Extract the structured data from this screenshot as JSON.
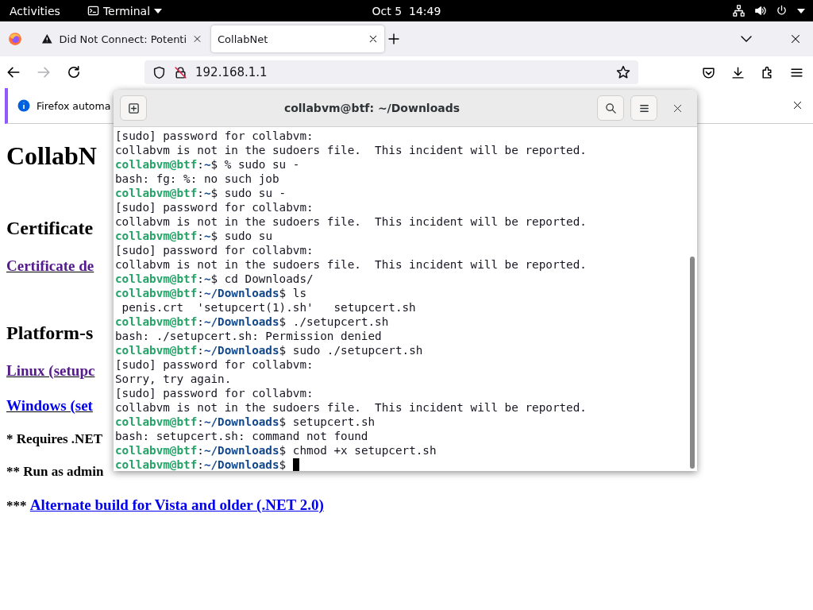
{
  "top_bar": {
    "activities": "Activities",
    "app_menu": "Terminal",
    "clock": "Oct 5  14:49"
  },
  "browser": {
    "tabs": [
      {
        "title": "Did Not Connect: Potenti",
        "kind": "warning",
        "selected": false
      },
      {
        "title": "CollabNet",
        "kind": "plain",
        "selected": true
      }
    ],
    "forward": {
      "disabled": true
    },
    "address": "192.168.1.1",
    "notification": "Firefox automa",
    "page": [
      {
        "kind": "h1",
        "text": "CollabN"
      },
      {
        "kind": "h2",
        "text": "Certificate"
      },
      {
        "kind": "link",
        "text": "Certificate de",
        "visited": true
      },
      {
        "kind": "h2",
        "text": "Platform-s"
      },
      {
        "kind": "link",
        "text": "Linux (setupc",
        "visited": true
      },
      {
        "kind": "link",
        "text": "Windows (set",
        "visited": false
      },
      {
        "kind": "note",
        "text": "* Requires .NET"
      },
      {
        "kind": "note",
        "text": "** Run as admin"
      },
      {
        "kind": "note_link",
        "prefix": "***",
        "text": "Alternate build for Vista and older (.NET 2.0)",
        "visited": false
      }
    ]
  },
  "terminal": {
    "title": "collabvm@btf: ~/Downloads",
    "lines": [
      {
        "kind": "output",
        "text": "[sudo] password for collabvm:"
      },
      {
        "kind": "output",
        "text": "collabvm is not in the sudoers file.  This incident will be reported."
      },
      {
        "kind": "prompt",
        "user": "collabvm@btf",
        "sep": ":",
        "path": "~",
        "rest": "$ % sudo su -",
        "cursor": false
      },
      {
        "kind": "output",
        "text": "bash: fg: %: no such job"
      },
      {
        "kind": "prompt",
        "user": "collabvm@btf",
        "sep": ":",
        "path": "~",
        "rest": "$ sudo su -",
        "cursor": false
      },
      {
        "kind": "output",
        "text": "[sudo] password for collabvm:"
      },
      {
        "kind": "output",
        "text": "collabvm is not in the sudoers file.  This incident will be reported."
      },
      {
        "kind": "prompt",
        "user": "collabvm@btf",
        "sep": ":",
        "path": "~",
        "rest": "$ sudo su",
        "cursor": false
      },
      {
        "kind": "output",
        "text": "[sudo] password for collabvm:"
      },
      {
        "kind": "output",
        "text": "collabvm is not in the sudoers file.  This incident will be reported."
      },
      {
        "kind": "prompt",
        "user": "collabvm@btf",
        "sep": ":",
        "path": "~",
        "rest": "$ cd Downloads/",
        "cursor": false
      },
      {
        "kind": "prompt",
        "user": "collabvm@btf",
        "sep": ":",
        "path": "~/Downloads",
        "rest": "$ ls",
        "cursor": false
      },
      {
        "kind": "output",
        "text": " penis.crt  'setupcert(1).sh'   setupcert.sh"
      },
      {
        "kind": "prompt",
        "user": "collabvm@btf",
        "sep": ":",
        "path": "~/Downloads",
        "rest": "$ ./setupcert.sh",
        "cursor": false
      },
      {
        "kind": "output",
        "text": "bash: ./setupcert.sh: Permission denied"
      },
      {
        "kind": "prompt",
        "user": "collabvm@btf",
        "sep": ":",
        "path": "~/Downloads",
        "rest": "$ sudo ./setupcert.sh",
        "cursor": false
      },
      {
        "kind": "output",
        "text": "[sudo] password for collabvm:"
      },
      {
        "kind": "output",
        "text": "Sorry, try again."
      },
      {
        "kind": "output",
        "text": "[sudo] password for collabvm:"
      },
      {
        "kind": "output",
        "text": "collabvm is not in the sudoers file.  This incident will be reported."
      },
      {
        "kind": "prompt",
        "user": "collabvm@btf",
        "sep": ":",
        "path": "~/Downloads",
        "rest": "$ setupcert.sh",
        "cursor": false
      },
      {
        "kind": "output",
        "text": "bash: setupcert.sh: command not found"
      },
      {
        "kind": "prompt",
        "user": "collabvm@btf",
        "sep": ":",
        "path": "~/Downloads",
        "rest": "$ chmod +x setupcert.sh",
        "cursor": false
      },
      {
        "kind": "prompt",
        "user": "collabvm@btf",
        "sep": ":",
        "path": "~/Downloads",
        "rest": "$ ",
        "cursor": true
      }
    ]
  }
}
